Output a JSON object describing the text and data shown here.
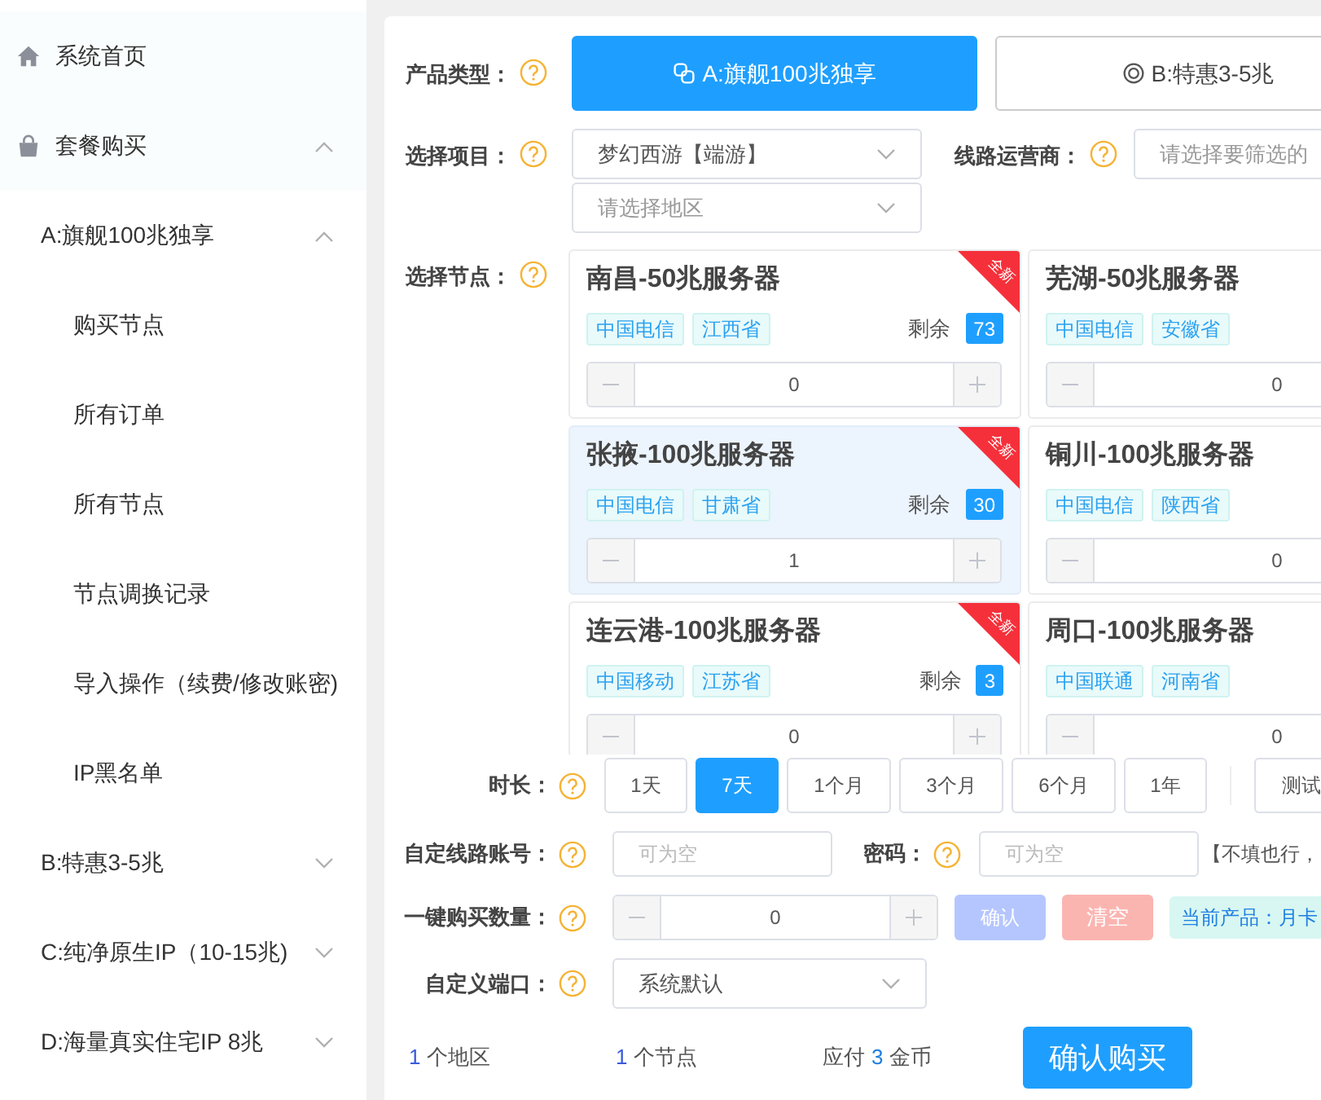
{
  "sidebar": {
    "items": [
      {
        "label": "系统首页"
      },
      {
        "label": "套餐购买",
        "expanded": true,
        "children": [
          {
            "label": "A:旗舰100兆独享",
            "expanded": true,
            "children": [
              {
                "label": "购买节点"
              },
              {
                "label": "所有订单"
              },
              {
                "label": "所有节点"
              },
              {
                "label": "节点调换记录"
              },
              {
                "label": "导入操作（续费/修改账密)"
              },
              {
                "label": "IP黑名单"
              }
            ]
          },
          {
            "label": "B:特惠3-5兆",
            "expanded": false
          },
          {
            "label": "C:纯净原生IP（10-15兆)",
            "expanded": false
          },
          {
            "label": "D:海量真实住宅IP 8兆",
            "expanded": false
          }
        ]
      }
    ]
  },
  "product_type": {
    "label": "产品类型：",
    "options": [
      {
        "label": "A:旗舰100兆独享",
        "selected": true
      },
      {
        "label": "B:特惠3-5兆",
        "selected": false
      }
    ]
  },
  "project": {
    "label": "选择项目：",
    "value": "梦幻西游【端游】",
    "region_placeholder": "请选择地区"
  },
  "carrier": {
    "label": "线路运营商：",
    "placeholder": "请选择要筛选的"
  },
  "nodes": {
    "label": "选择节点：",
    "items": [
      {
        "title": "南昌-50兆服务器",
        "tags": [
          "中国电信",
          "江西省"
        ],
        "remaining_label": "剩余",
        "remaining": "73",
        "quantity": "0",
        "badge": "全新",
        "selected": false
      },
      {
        "title": "芜湖-50兆服务器",
        "tags": [
          "中国电信",
          "安徽省"
        ],
        "quantity": "0",
        "selected": false
      },
      {
        "title": "张掖-100兆服务器",
        "tags": [
          "中国电信",
          "甘肃省"
        ],
        "remaining_label": "剩余",
        "remaining": "30",
        "quantity": "1",
        "badge": "全新",
        "selected": true
      },
      {
        "title": "铜川-100兆服务器",
        "tags": [
          "中国电信",
          "陕西省"
        ],
        "quantity": "0",
        "selected": false
      },
      {
        "title": "连云港-100兆服务器",
        "tags": [
          "中国移动",
          "江苏省"
        ],
        "remaining_label": "剩余",
        "remaining": "3",
        "quantity": "0",
        "badge": "全新",
        "selected": false
      },
      {
        "title": "周口-100兆服务器",
        "tags": [
          "中国联通",
          "河南省"
        ],
        "quantity": "0",
        "selected": false
      }
    ]
  },
  "duration": {
    "label": "时长：",
    "options": [
      {
        "label": "1天",
        "selected": false
      },
      {
        "label": "7天",
        "selected": true
      },
      {
        "label": "1个月",
        "selected": false
      },
      {
        "label": "3个月",
        "selected": false
      },
      {
        "label": "6个月",
        "selected": false
      },
      {
        "label": "1年",
        "selected": false
      }
    ],
    "trial": "测试"
  },
  "account": {
    "label": "自定线路账号：",
    "placeholder": "可为空",
    "password_label": "密码：",
    "password_placeholder": "可为空",
    "note": "【不填也行，"
  },
  "bulk": {
    "label": "一键购买数量：",
    "quantity": "0",
    "confirm": "确认",
    "clear": "清空",
    "product_tag": "当前产品：月卡"
  },
  "port": {
    "label": "自定义端口：",
    "value": "系统默认"
  },
  "summary": {
    "items": [
      {
        "value": "1",
        "text": "个地区"
      },
      {
        "value": "1",
        "text": "个节点"
      }
    ],
    "pay_prefix": "应付",
    "pay_value": "3",
    "pay_suffix": "金币",
    "submit": "确认购买"
  }
}
